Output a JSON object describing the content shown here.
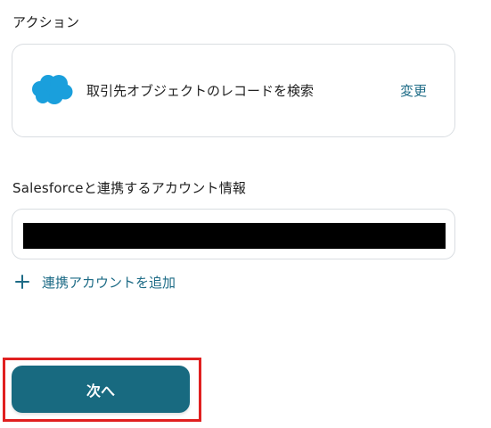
{
  "action_section": {
    "label": "アクション",
    "card": {
      "icon": "salesforce-cloud-icon",
      "action_name": "取引先オブジェクトのレコードを検索",
      "change_label": "変更"
    }
  },
  "account_section": {
    "label": "Salesforceと連携するアカウント情報",
    "field_value": "",
    "add_account_label": "連携アカウントを追加"
  },
  "footer": {
    "next_label": "次へ"
  },
  "colors": {
    "accent": "#1d6b86",
    "button": "#186a80",
    "salesforce_blue": "#1a9fdc",
    "highlight": "#e02020"
  }
}
